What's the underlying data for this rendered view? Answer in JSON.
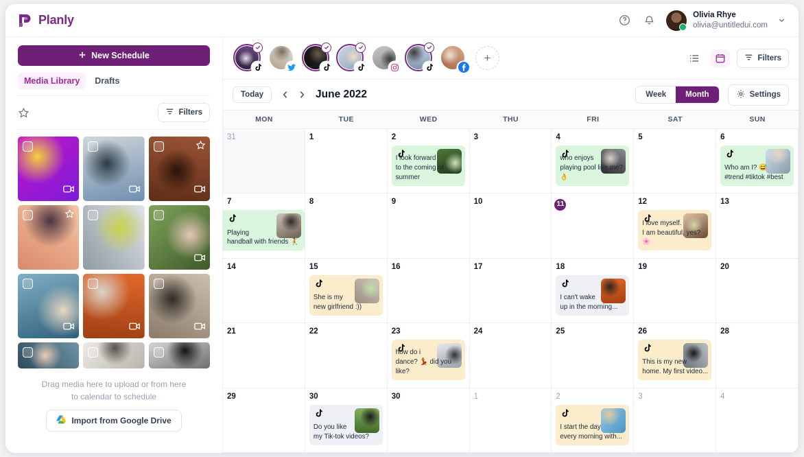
{
  "app": {
    "brand": "Planly"
  },
  "topbar": {
    "help_icon": "help-circle-icon",
    "bell_icon": "bell-icon",
    "user": {
      "name": "Olivia Rhye",
      "email": "olivia@untitledui.com"
    },
    "chevron": "chevron-down-icon"
  },
  "sidebar": {
    "new_schedule": "New Schedule",
    "plus_icon": "plus-icon",
    "tabs": [
      {
        "label": "Media Library",
        "active": true
      },
      {
        "label": "Drafts",
        "active": false
      }
    ],
    "star_icon": "star-icon",
    "filters": "Filters",
    "media": [
      {
        "name": "media-item-1",
        "video": true,
        "starred": false,
        "short": false,
        "c1": "#c216c8",
        "c2": "#7d1bd8",
        "c3": "#f2d23a"
      },
      {
        "name": "media-item-2",
        "video": true,
        "starred": false,
        "short": false,
        "c1": "#cfd5d8",
        "c2": "#6f8fb0",
        "c3": "#2b3b46"
      },
      {
        "name": "media-item-3",
        "video": true,
        "starred": true,
        "short": false,
        "c1": "#9c5434",
        "c2": "#5e2d18",
        "c3": "#2a1309"
      },
      {
        "name": "media-item-4",
        "video": false,
        "starred": true,
        "short": false,
        "c1": "#f6c6a4",
        "c2": "#d98a6a",
        "c3": "#4a3340"
      },
      {
        "name": "media-item-5",
        "video": false,
        "starred": false,
        "short": false,
        "c1": "#dfe3e6",
        "c2": "#8f9aa3",
        "c3": "#c9d24a"
      },
      {
        "name": "media-item-6",
        "video": true,
        "starred": false,
        "short": false,
        "c1": "#7ea35a",
        "c2": "#3e5a2a",
        "c3": "#e4c6b4"
      },
      {
        "name": "media-item-7",
        "video": true,
        "starred": false,
        "short": false,
        "c1": "#7fb0c6",
        "c2": "#2f5f7a",
        "c3": "#e8d7c2"
      },
      {
        "name": "media-item-8",
        "video": true,
        "starred": false,
        "short": false,
        "c1": "#e2682a",
        "c2": "#a13f14",
        "c3": "#d9d4cc"
      },
      {
        "name": "media-item-9",
        "video": true,
        "starred": false,
        "short": false,
        "c1": "#cdbfae",
        "c2": "#8a7b6a",
        "c3": "#2e2a26"
      },
      {
        "name": "media-item-10",
        "video": false,
        "starred": false,
        "short": true,
        "c1": "#6f93a6",
        "c2": "#2d4a5c",
        "c3": "#e7cdb6"
      },
      {
        "name": "media-item-11",
        "video": false,
        "starred": false,
        "short": true,
        "c1": "#eceae5",
        "c2": "#b9b4ab",
        "c3": "#55514b"
      },
      {
        "name": "media-item-12",
        "video": false,
        "starred": false,
        "short": true,
        "c1": "#d5d5d5",
        "c2": "#6e6e6e",
        "c3": "#141414"
      }
    ],
    "drop_note_line1": "Drag media here to upload or from here",
    "drop_note_line2": "to calendar to schedule",
    "gdrive_button": "Import from Google Drive",
    "gdrive_icon": "google-drive-icon"
  },
  "accounts": [
    {
      "name": "account-1",
      "platform": "tiktok",
      "verified": true,
      "ring": true,
      "c1": "#6b4a86",
      "c2": "#2b1f3a",
      "c3": "#e7dbe7"
    },
    {
      "name": "account-2",
      "platform": "twitter",
      "verified": false,
      "ring": false,
      "c1": "#dfe6ea",
      "c2": "#b59b82",
      "c3": "#7d6a58"
    },
    {
      "name": "account-3",
      "platform": "tiktok",
      "verified": true,
      "ring": true,
      "c1": "#2b2b2b",
      "c2": "#0f0f0f",
      "c3": "#6a5a4e"
    },
    {
      "name": "account-4",
      "platform": "tiktok",
      "verified": true,
      "ring": true,
      "c1": "#cfd9e4",
      "c2": "#8fa3bd",
      "c3": "#f0ddc8"
    },
    {
      "name": "account-5",
      "platform": "instagram",
      "verified": false,
      "ring": false,
      "c1": "#c9c9c9",
      "c2": "#8e8e8e",
      "c3": "#3a3a3a"
    },
    {
      "name": "account-6",
      "platform": "tiktok",
      "verified": true,
      "ring": true,
      "c1": "#c2d4e6",
      "c2": "#7e93ab",
      "c3": "#3c3a38"
    },
    {
      "name": "account-7",
      "platform": "facebook",
      "verified": false,
      "ring": false,
      "c1": "#d9a98a",
      "c2": "#a66a48",
      "c3": "#efe2d2"
    }
  ],
  "add_account": "+",
  "view_tools": {
    "list_icon": "list-view-icon",
    "calendar_icon": "calendar-view-icon",
    "filters": "Filters",
    "filter_icon": "filter-icon"
  },
  "calendar": {
    "today_button": "Today",
    "prev_icon": "chevron-left-icon",
    "next_icon": "chevron-right-icon",
    "title": "June 2022",
    "views": [
      {
        "label": "Week",
        "active": false
      },
      {
        "label": "Month",
        "active": true
      }
    ],
    "settings_button": "Settings",
    "settings_icon": "gear-icon",
    "weekdays": [
      "MON",
      "TUE",
      "WED",
      "THU",
      "FRI",
      "SAT",
      "SUN"
    ],
    "today_day": 11,
    "cells": [
      {
        "day": "31",
        "muted": true,
        "dim": true
      },
      {
        "day": "1",
        "muted": false,
        "dim": false
      },
      {
        "day": "2",
        "muted": false,
        "dim": false,
        "event": {
          "platform": "tiktok",
          "color": "#d9f5dd",
          "line1": "I look forward",
          "line2": "to the coming of summer",
          "t1": "#4f7a3a",
          "t2": "#20351a",
          "t3": "#cfe0bb"
        }
      },
      {
        "day": "3",
        "muted": false,
        "dim": false
      },
      {
        "day": "4",
        "muted": false,
        "dim": false,
        "event": {
          "platform": "tiktok",
          "color": "#d9f5dd",
          "line1": "who enjoys",
          "line2": "playing pool like me? 👌",
          "t1": "#8e8e92",
          "t2": "#2b2b30",
          "t3": "#d8d4cc"
        }
      },
      {
        "day": "5",
        "muted": false,
        "dim": false
      },
      {
        "day": "6",
        "muted": false,
        "dim": false,
        "event": {
          "platform": "tiktok",
          "color": "#d9f5dd",
          "line1": "Who am I? 😅",
          "line2": "#trend #tiktok #best",
          "t1": "#cfe0ea",
          "t2": "#8a9aa8",
          "t3": "#e8d6c4"
        }
      },
      {
        "day": "7",
        "muted": false,
        "dim": false,
        "full": true,
        "event": {
          "platform": "tiktok",
          "color": "#d9f5dd",
          "line1": "Playing",
          "line2": "handball with friends 🤾",
          "t1": "#cdc4b8",
          "t2": "#6c5f52",
          "t3": "#2f2a26"
        }
      },
      {
        "day": "8",
        "muted": false,
        "dim": false
      },
      {
        "day": "9",
        "muted": false,
        "dim": false
      },
      {
        "day": "10",
        "muted": false,
        "dim": false
      },
      {
        "day": "11",
        "muted": false,
        "dim": false,
        "badge": true
      },
      {
        "day": "12",
        "muted": false,
        "dim": false,
        "event": {
          "platform": "tiktok",
          "color": "#fbeccb",
          "line1": "I love myself.",
          "line2": "I am beautiful, yes? 🌸",
          "t1": "#e0c3a6",
          "t2": "#6a4a36",
          "t3": "#cfd6a8"
        }
      },
      {
        "day": "13",
        "muted": false,
        "dim": false
      },
      {
        "day": "14",
        "muted": false,
        "dim": false
      },
      {
        "day": "15",
        "muted": false,
        "dim": false,
        "event": {
          "platform": "tiktok",
          "color": "#fbeccb",
          "line1": "She is my",
          "line2": "new girlfriend :))",
          "t1": "#cfc6bb",
          "t2": "#9a8e80",
          "t3": "#bfe0a8"
        }
      },
      {
        "day": "16",
        "muted": false,
        "dim": false
      },
      {
        "day": "17",
        "muted": false,
        "dim": false
      },
      {
        "day": "18",
        "muted": false,
        "dim": false,
        "event": {
          "platform": "tiktok",
          "color": "#eef0f6",
          "line1": "I can't wake",
          "line2": "up in the morning...",
          "t1": "#e2692a",
          "t2": "#a4400f",
          "t3": "#2a2523"
        }
      },
      {
        "day": "19",
        "muted": false,
        "dim": false
      },
      {
        "day": "20",
        "muted": false,
        "dim": false
      },
      {
        "day": "21",
        "muted": false,
        "dim": false
      },
      {
        "day": "22",
        "muted": false,
        "dim": false
      },
      {
        "day": "23",
        "muted": false,
        "dim": false,
        "event": {
          "platform": "tiktok",
          "color": "#fbeccb",
          "line1": "how do i",
          "line2": "dance? 💃 did you like?",
          "t1": "#e8eaec",
          "t2": "#9aa1a7",
          "t3": "#2f3438"
        }
      },
      {
        "day": "24",
        "muted": false,
        "dim": false
      },
      {
        "day": "25",
        "muted": false,
        "dim": false
      },
      {
        "day": "26",
        "muted": false,
        "dim": false,
        "event": {
          "platform": "tiktok",
          "color": "#fbeccb",
          "line1": "This is my new",
          "line2": "home. My first video...",
          "t1": "#b9bec4",
          "t2": "#6d737a",
          "t3": "#17181a"
        }
      },
      {
        "day": "28",
        "muted": false,
        "dim": false
      },
      {
        "day": "29",
        "muted": false,
        "dim": false
      },
      {
        "day": "30",
        "muted": false,
        "dim": false,
        "event": {
          "platform": "tiktok",
          "color": "#eef0f6",
          "line1": "Do you like",
          "line2": "my Tik-tok videos?",
          "t1": "#86b25e",
          "t2": "#3f6a2a",
          "t3": "#1b1b1b"
        }
      },
      {
        "day": "30",
        "muted": false,
        "dim": false
      },
      {
        "day": "1",
        "muted": true,
        "dim": false
      },
      {
        "day": "2",
        "muted": true,
        "dim": false,
        "event": {
          "platform": "tiktok",
          "color": "#fbeccb",
          "line1": "I start the day",
          "line2": "every morning with...",
          "t1": "#8ec9e8",
          "t2": "#4e94c2",
          "t3": "#e0c89f"
        }
      },
      {
        "day": "3",
        "muted": true,
        "dim": false
      },
      {
        "day": "4",
        "muted": true,
        "dim": false
      }
    ]
  },
  "colors": {
    "brand_purple": "#6e2076",
    "accent_purple": "#9c2ba0",
    "event_green": "#d9f5dd",
    "event_cream": "#fbeccb",
    "event_gray": "#eef0f6"
  }
}
